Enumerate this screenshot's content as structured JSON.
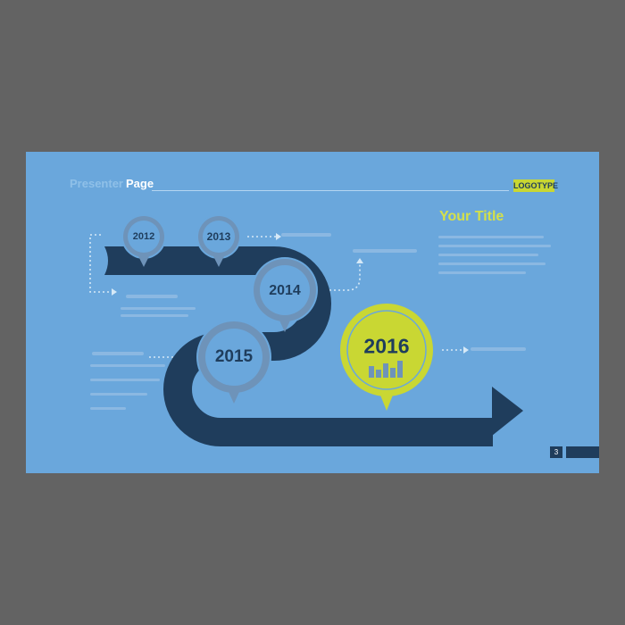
{
  "header": {
    "presenter": "Presenter",
    "page": "Page",
    "logotype": "LOGOTYPE"
  },
  "title": "Your Title",
  "timeline": {
    "years": [
      "2012",
      "2013",
      "2014",
      "2015",
      "2016"
    ],
    "highlight_year": "2016"
  },
  "page_number": "3",
  "colors": {
    "background": "#6aa7dc",
    "path": "#1f3d5c",
    "pin": "#6e93b9",
    "highlight": "#c9d733",
    "frame": "#636363"
  }
}
